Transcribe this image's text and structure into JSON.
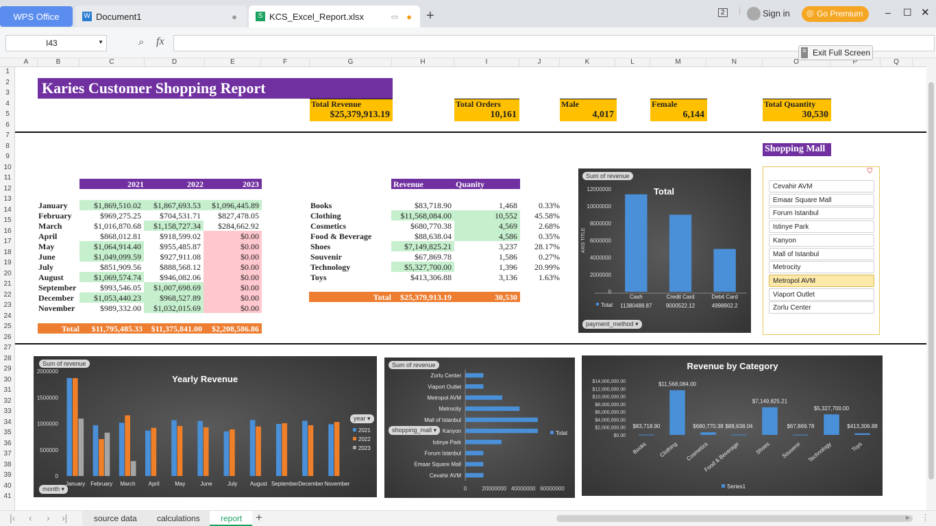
{
  "app": {
    "brand": "WPS Office",
    "tabs": [
      {
        "label": "Document1"
      },
      {
        "label": "KCS_Excel_Report.xlsx"
      }
    ],
    "sign_in": "Sign in",
    "premium": "Go Premium",
    "badge": "2"
  },
  "formula_bar": {
    "cell_ref": "I43",
    "fx": "fx",
    "value": ""
  },
  "exit_fullscreen": "Exit Full Screen",
  "columns": [
    "A",
    "B",
    "C",
    "D",
    "E",
    "F",
    "G",
    "H",
    "I",
    "J",
    "K",
    "L",
    "M",
    "N",
    "O",
    "P",
    "Q"
  ],
  "rows": [
    "1",
    "2",
    "3",
    "4",
    "5",
    "6",
    "7",
    "8",
    "9",
    "10",
    "11",
    "12",
    "13",
    "14",
    "15",
    "16",
    "17",
    "18",
    "19",
    "20",
    "21",
    "22",
    "23",
    "24",
    "25",
    "26",
    "27",
    "28",
    "29",
    "30",
    "31",
    "32",
    "33",
    "34",
    "35",
    "36",
    "37",
    "38",
    "39",
    "40",
    "41"
  ],
  "report": {
    "title": "Karies Customer Shopping Report",
    "kpis": [
      {
        "label": "Total Revenue",
        "value": "$25,379,913.19"
      },
      {
        "label": "Total Orders",
        "value": "10,161"
      },
      {
        "label": "Male",
        "value": "4,017"
      },
      {
        "label": "Female",
        "value": "6,144"
      },
      {
        "label": "Total Quantity",
        "value": "30,530"
      }
    ],
    "monthly": {
      "headers": [
        "2021",
        "2022",
        "2023"
      ],
      "rows": [
        {
          "m": "January",
          "a": "$1,869,510.02",
          "b": "$1,867,693.53",
          "c": "$1,096,445.89",
          "fa": "g",
          "fb": "g",
          "fc": "g"
        },
        {
          "m": "February",
          "a": "$969,275.25",
          "b": "$704,531.71",
          "c": "$827,478.05",
          "fa": "",
          "fb": "",
          "fc": ""
        },
        {
          "m": "March",
          "a": "$1,016,870.68",
          "b": "$1,158,727.34",
          "c": "$284,662.92",
          "fa": "",
          "fb": "g",
          "fc": ""
        },
        {
          "m": "April",
          "a": "$868,012.81",
          "b": "$918,599.02",
          "c": "$0.00",
          "fa": "",
          "fb": "",
          "fc": "r"
        },
        {
          "m": "May",
          "a": "$1,064,914.40",
          "b": "$955,485.87",
          "c": "$0.00",
          "fa": "g",
          "fb": "",
          "fc": "r"
        },
        {
          "m": "June",
          "a": "$1,049,099.59",
          "b": "$927,911.08",
          "c": "$0.00",
          "fa": "g",
          "fb": "",
          "fc": "r"
        },
        {
          "m": "July",
          "a": "$851,909.56",
          "b": "$888,568.12",
          "c": "$0.00",
          "fa": "",
          "fb": "",
          "fc": "r"
        },
        {
          "m": "August",
          "a": "$1,069,574.74",
          "b": "$946,082.06",
          "c": "$0.00",
          "fa": "g",
          "fb": "",
          "fc": "r"
        },
        {
          "m": "September",
          "a": "$993,546.05",
          "b": "$1,007,698.69",
          "c": "$0.00",
          "fa": "",
          "fb": "g",
          "fc": "r"
        },
        {
          "m": "December",
          "a": "$1,053,440.23",
          "b": "$968,527.89",
          "c": "$0.00",
          "fa": "g",
          "fb": "g",
          "fc": "r"
        },
        {
          "m": "November",
          "a": "$989,332.00",
          "b": "$1,032,015.69",
          "c": "$0.00",
          "fa": "",
          "fb": "g",
          "fc": "r"
        }
      ],
      "total_label": "Total",
      "totals": [
        "$11,795,485.33",
        "$11,375,841.00",
        "$2,208,586.86"
      ]
    },
    "category": {
      "headers": [
        "Revenue",
        "Quanity"
      ],
      "rows": [
        {
          "c": "Books",
          "rev": "$83,718.90",
          "qty": "1,468",
          "pct": "0.33%",
          "fr": "",
          "fq": ""
        },
        {
          "c": "Clothing",
          "rev": "$11,568,084.00",
          "qty": "10,552",
          "pct": "45.58%",
          "fr": "g",
          "fq": "g"
        },
        {
          "c": "Cosmetics",
          "rev": "$680,770.38",
          "qty": "4,569",
          "pct": "2.68%",
          "fr": "",
          "fq": "g"
        },
        {
          "c": "Food & Beverage",
          "rev": "$88,638.04",
          "qty": "4,586",
          "pct": "0.35%",
          "fr": "",
          "fq": "g"
        },
        {
          "c": "Shoes",
          "rev": "$7,149,825.21",
          "qty": "3,237",
          "pct": "28.17%",
          "fr": "g",
          "fq": ""
        },
        {
          "c": "Souvenir",
          "rev": "$67,869.78",
          "qty": "1,586",
          "pct": "0.27%",
          "fr": "",
          "fq": ""
        },
        {
          "c": "Technology",
          "rev": "$5,327,700.00",
          "qty": "1,396",
          "pct": "20.99%",
          "fr": "g",
          "fq": ""
        },
        {
          "c": "Toys",
          "rev": "$413,306.88",
          "qty": "3,136",
          "pct": "1.63%",
          "fr": "",
          "fq": ""
        }
      ],
      "total_label": "Total",
      "total_rev": "$25,379,913.19",
      "total_qty": "30,530"
    },
    "slicer": {
      "title": "Shopping Mall",
      "items": [
        "Cevahir AVM",
        "Emaar Square Mall",
        "Forum Istanbul",
        "Istinye Park",
        "Kanyon",
        "Mall of Istanbul",
        "Metrocity",
        "Metropol AVM",
        "Viaport Outlet",
        "Zorlu Center"
      ],
      "selected": "Metropol AVM"
    }
  },
  "charts": {
    "payment": {
      "sum_label": "Sum of revenue",
      "axis_title": "AXIS TITLE",
      "filter": "payment_method",
      "legend": "Total"
    },
    "yearly": {
      "sum_label": "Sum of revenue",
      "filter_year": "year",
      "filter_month": "month"
    },
    "mall": {
      "sum_label": "Sum of revenue",
      "filter": "shopping_mall",
      "legend": "Total"
    },
    "category": {
      "legend": "Series1"
    }
  },
  "chart_data": [
    {
      "type": "bar",
      "title": "Total",
      "categories": [
        "Cash",
        "Credit Card",
        "Debit Card"
      ],
      "values": [
        11380488.87,
        9000522.12,
        4998902.2
      ],
      "value_labels": [
        "11380488.87",
        "9000522.12",
        "4998902.2"
      ],
      "series_name": "Total",
      "ylim": [
        0,
        12000000
      ],
      "yticks": [
        "12000000",
        "10000000",
        "8000000",
        "6000000",
        "4000000",
        "2000000",
        "0"
      ]
    },
    {
      "type": "bar",
      "title": "Yearly Revenue",
      "categories": [
        "January",
        "February",
        "March",
        "April",
        "May",
        "June",
        "July",
        "August",
        "September",
        "December",
        "November"
      ],
      "series": [
        {
          "name": "2021",
          "color": "#4a90d9",
          "values": [
            1869510.02,
            969275.25,
            1016870.68,
            868012.81,
            1064914.4,
            1049099.59,
            851909.56,
            1069574.74,
            993546.05,
            1053440.23,
            989332.0
          ]
        },
        {
          "name": "2022",
          "color": "#f07f2a",
          "values": [
            1867693.53,
            704531.71,
            1158727.34,
            918599.02,
            955485.87,
            927911.08,
            888568.12,
            946082.06,
            1007698.69,
            968527.89,
            1032015.69
          ]
        },
        {
          "name": "2023",
          "color": "#a5a5a5",
          "values": [
            1096445.89,
            827478.05,
            284662.92,
            0,
            0,
            0,
            0,
            0,
            0,
            0,
            0
          ]
        }
      ],
      "ylim": [
        0,
        2000000
      ],
      "yticks": [
        "2000000",
        "1500000",
        "1000000",
        "500000",
        "0"
      ]
    },
    {
      "type": "bar",
      "orientation": "horizontal",
      "categories": [
        "Zorlu Center",
        "Viaport Outlet",
        "Metropol AVM",
        "Metrocity",
        "Mall of Istanbul",
        "Kanyon",
        "Istinye Park",
        "Forum Istanbul",
        "Emaar Square Mall",
        "Cevahir AVM"
      ],
      "values": [
        1250000,
        1250000,
        2550000,
        3750000,
        5000000,
        5000000,
        2500000,
        1250000,
        1250000,
        1250000
      ],
      "xticks": [
        "0",
        "20000000",
        "40000000",
        "60000000"
      ],
      "xlim": [
        0,
        6000000
      ],
      "series_name": "Total"
    },
    {
      "type": "bar",
      "title": "Revenue by Category",
      "categories": [
        "Books",
        "Clothing",
        "Cosmetics",
        "Food & Beverage",
        "Shoes",
        "Souvenir",
        "Technology",
        "Toys"
      ],
      "values": [
        83718.9,
        11568084.0,
        680770.38,
        88638.04,
        7149825.21,
        67869.78,
        5327700.0,
        413306.88
      ],
      "value_labels": [
        "$83,718.90",
        "$11,568,084.00",
        "$680,770.38",
        "$88,638.04",
        "$7,149,825.21",
        "$67,869.78",
        "$5,327,700.00",
        "$413,306.88"
      ],
      "ylim": [
        0,
        14000000
      ],
      "yticks": [
        "$14,000,000.00",
        "$12,000,000.00",
        "$10,000,000.00",
        "$8,000,000.00",
        "$6,000,000.00",
        "$4,000,000.00",
        "$2,000,000.00",
        "$0.00"
      ],
      "series_name": "Series1"
    }
  ],
  "sheets": {
    "tabs": [
      "source data",
      "calculations",
      "report"
    ],
    "active": "report"
  },
  "colors": {
    "purple": "#7030a0",
    "orange": "#ed7d31",
    "gold": "#ffc000",
    "green_fill": "#c6efce",
    "red_fill": "#ffc7ce",
    "bar_blue": "#4a90d9"
  }
}
